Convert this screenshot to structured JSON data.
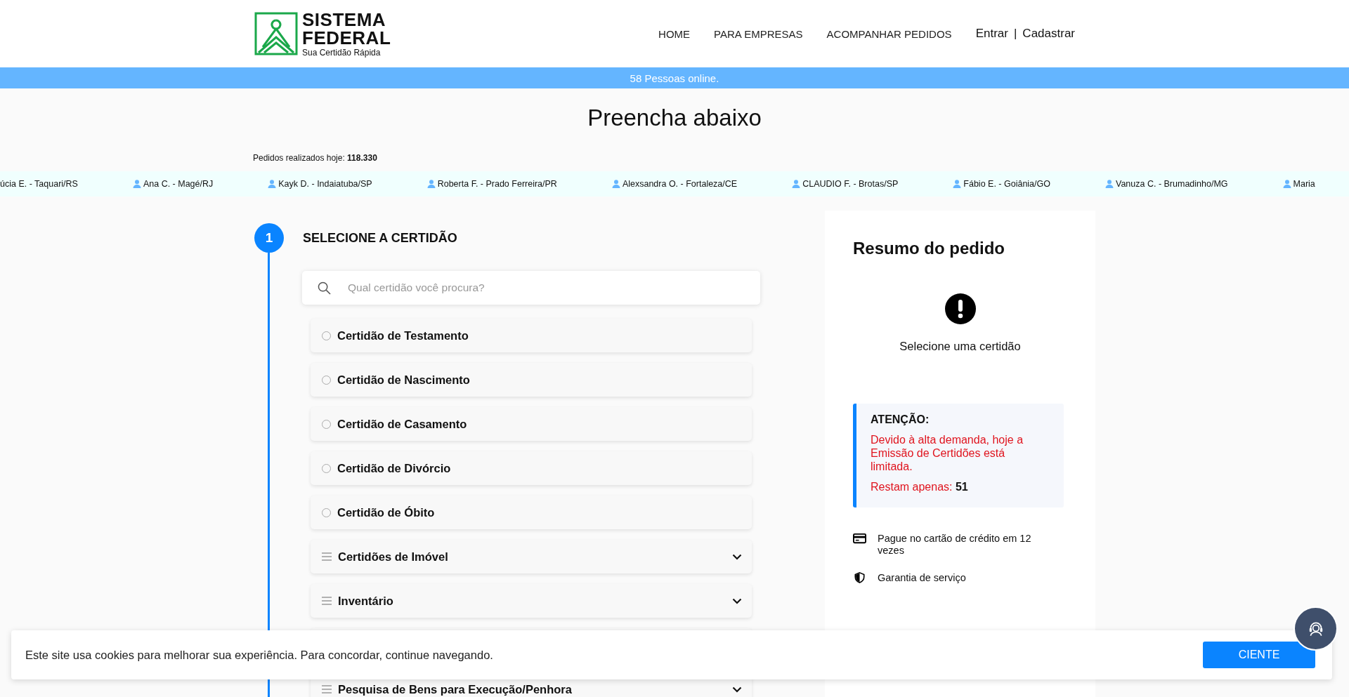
{
  "header": {
    "logo": {
      "title_line1": "SISTEMA",
      "title_line2": "FEDERAL",
      "tagline": "Sua Certidão Rápida"
    },
    "nav": [
      {
        "label": "HOME"
      },
      {
        "label": "PARA EMPRESAS"
      },
      {
        "label": "ACOMPANHAR PEDIDOS"
      }
    ],
    "auth": {
      "login": "Entrar",
      "separator": "|",
      "register": "Cadastrar"
    }
  },
  "online_bar": "58 Pessoas online.",
  "page_title": "Preencha abaixo",
  "orders_today": {
    "label": "Pedidos realizados hoje:",
    "value": "118.330"
  },
  "ticker": [
    {
      "text": "úcia E. - Taquari/RS",
      "icon": false
    },
    {
      "text": "Ana C. - Magé/RJ",
      "icon": true
    },
    {
      "text": "Kayk D. - Indaiatuba/SP",
      "icon": true
    },
    {
      "text": "Roberta F. - Prado Ferreira/PR",
      "icon": true
    },
    {
      "text": "Alexsandra O. - Fortaleza/CE",
      "icon": true
    },
    {
      "text": "CLAUDIO F. - Brotas/SP",
      "icon": true
    },
    {
      "text": "Fábio E. - Goiânia/GO",
      "icon": true
    },
    {
      "text": "Vanuza C. - Brumadinho/MG",
      "icon": true
    },
    {
      "text": "Maria",
      "icon": true
    }
  ],
  "step": {
    "number": "1",
    "title": "SELECIONE A CERTIDÃO"
  },
  "search": {
    "placeholder": "Qual certidão você procura?"
  },
  "options": [
    {
      "kind": "radio",
      "label": "Certidão de Testamento",
      "selected": false
    },
    {
      "kind": "radio",
      "label": "Certidão de Nascimento",
      "selected": false
    },
    {
      "kind": "radio",
      "label": "Certidão de Casamento",
      "selected": false
    },
    {
      "kind": "radio",
      "label": "Certidão de Divórcio",
      "selected": false
    },
    {
      "kind": "radio",
      "label": "Certidão de Óbito",
      "selected": false
    },
    {
      "kind": "group",
      "label": "Certidões de Imóvel",
      "expanded": false
    },
    {
      "kind": "group",
      "label": "Inventário",
      "expanded": false
    },
    {
      "kind": "hidden"
    },
    {
      "kind": "group",
      "label": "Pesquisa de Bens para Execução/Penhora",
      "expanded": false
    }
  ],
  "summary": {
    "title": "Resumo do pedido",
    "empty_text": "Selecione uma certidão",
    "notice": {
      "title": "ATENÇÃO:",
      "message": "Devido à alta demanda, hoje a Emissão de Certidões está limitada.",
      "remaining_label": "Restam apenas:",
      "remaining_value": "51"
    },
    "features": [
      {
        "kind": "card",
        "text": "Pague no cartão de crédito em 12 vezes"
      },
      {
        "kind": "shield",
        "text": "Garantia de serviço"
      }
    ]
  },
  "cookie": {
    "text": "Este site usa cookies para melhorar sua experiência. Para concordar, continue navegando.",
    "button": "CIENTE"
  }
}
